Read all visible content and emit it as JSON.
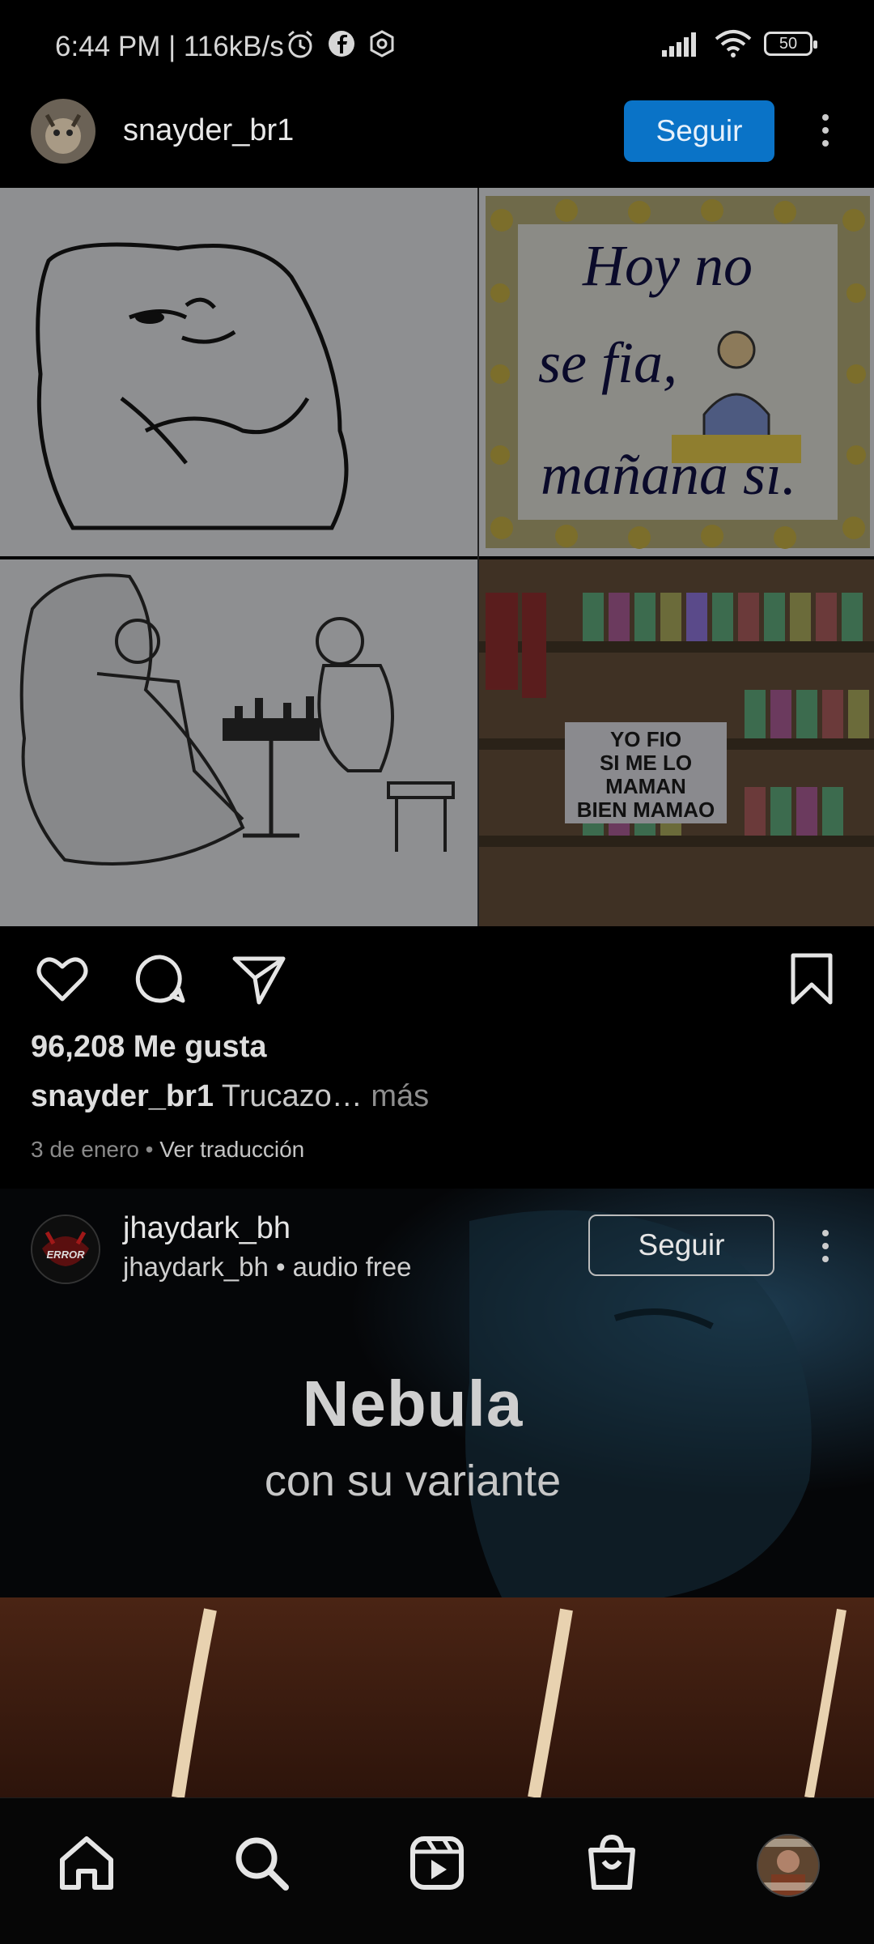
{
  "status_bar": {
    "time": "6:44 PM | 116kB/s",
    "battery": "50",
    "icons": [
      "alarm-icon",
      "facebook-icon",
      "settings-hex-icon",
      "signal-icon",
      "wifi-icon",
      "battery-icon"
    ]
  },
  "post": {
    "username": "snayder_br1",
    "follow_label": "Seguir",
    "image": {
      "tile1_line1": "Hoy no",
      "tile1_line2": "se fia,",
      "tile1_line3": "mañana sí.",
      "sign_line1": "YO FIO",
      "sign_line2": "SI ME LO",
      "sign_line3": "MAMAN",
      "sign_line4": "BIEN MAMAO"
    },
    "likes": "96,208 Me gusta",
    "caption_user": "snayder_br1",
    "caption_text": "Trucazo…",
    "caption_more": "más",
    "date": "3 de enero",
    "separator": "•",
    "translate": "Ver traducción"
  },
  "reel": {
    "username": "jhaydark_bh",
    "subtitle": "jhaydark_bh • audio free",
    "avatar_text": "ERROR",
    "follow_label": "Seguir",
    "title": "Nebula",
    "subtitle_overlay": "con su variante"
  },
  "colors": {
    "follow_blue": "#0a73c7",
    "background": "#000000"
  }
}
